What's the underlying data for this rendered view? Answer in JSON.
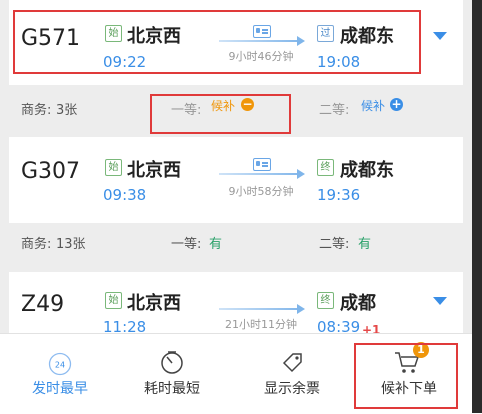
{
  "trains": [
    {
      "number": "G571",
      "from_tag": "始",
      "from": "北京西",
      "depart": "09:22",
      "duration": "9小时46分钟",
      "to_tag": "过",
      "to": "成都东",
      "arrive": "19:08",
      "seats": {
        "business_label": "商务:",
        "business_value": "3张",
        "first_label": "一等:",
        "first_value": "候补",
        "second_label": "二等:",
        "second_value": "候补"
      }
    },
    {
      "number": "G307",
      "from_tag": "始",
      "from": "北京西",
      "depart": "09:38",
      "duration": "9小时58分钟",
      "to_tag": "终",
      "to": "成都东",
      "arrive": "19:36",
      "seats": {
        "business_label": "商务:",
        "business_value": "13张",
        "first_label": "一等:",
        "first_value": "有",
        "second_label": "二等:",
        "second_value": "有"
      }
    },
    {
      "number": "Z49",
      "from_tag": "始",
      "from": "北京西",
      "depart": "11:28",
      "duration": "21小时11分钟",
      "to_tag": "终",
      "to": "成都",
      "arrive": "08:39",
      "day_offset": "+1"
    }
  ],
  "tabbar": {
    "tabs": [
      {
        "label": "发时最早",
        "icon": "clock-24-icon",
        "badge": "24",
        "active": true
      },
      {
        "label": "耗时最短",
        "icon": "stopwatch-icon",
        "active": false
      },
      {
        "label": "显示余票",
        "icon": "ticket-tag-icon",
        "active": false
      },
      {
        "label": "候补下单",
        "icon": "cart-icon",
        "badge": "1",
        "active": false
      }
    ]
  },
  "colors": {
    "accent": "#3a8ee6",
    "highlight_box": "#e03a3a",
    "waitlist": "#f0960a",
    "available": "#2aa16a"
  }
}
